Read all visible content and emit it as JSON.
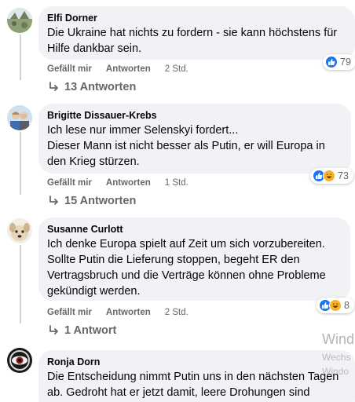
{
  "comments": [
    {
      "author": "Elfi Dorner",
      "text": "Die Ukraine hat nichts zu fordern - sie kann höchstens für\nHilfe dankbar sein.",
      "reactions": [
        "like"
      ],
      "reaction_count": "79",
      "like_label": "Gefällt mir",
      "reply_label": "Antworten",
      "time": "2 Std.",
      "replies_label": "13 Antworten"
    },
    {
      "author": "Brigitte Dissauer-Krebs",
      "text": "Ich lese nur immer Selenskyi fordert...\nDieser Mann ist nicht besser als Putin, er will Europa in\nden Krieg stürzen.",
      "reactions": [
        "like",
        "haha"
      ],
      "reaction_count": "73",
      "like_label": "Gefällt mir",
      "reply_label": "Antworten",
      "time": "1 Std.",
      "replies_label": "15 Antworten"
    },
    {
      "author": "Susanne Curlott",
      "text": "Ich denke Europa spielt auf Zeit um sich vorzubereiten.\nSollte Putin die Lieferung stoppen, begeht ER den\nVertragsbruch und die Verträge können ohne Probleme\ngekündigt werden.",
      "reactions": [
        "like",
        "haha"
      ],
      "reaction_count": "8",
      "like_label": "Gefällt mir",
      "reply_label": "Antworten",
      "time": "2 Std.",
      "replies_label": "1 Antwort"
    },
    {
      "author": "Ronja Dorn",
      "text": "Die Entscheidung nimmt Putin uns in den nächsten Tagen\nab. Gedroht hat er jetzt damit, leere Drohungen sind\neigentlich nicht sein"
    }
  ],
  "watermark": {
    "title": "Wind",
    "sub1": "Wechs",
    "sub2": "Windo"
  },
  "colors": {
    "bubble": "#f0f2f5",
    "meta_text": "#65676b",
    "like": "#1877f2",
    "haha": "#f7b125"
  }
}
